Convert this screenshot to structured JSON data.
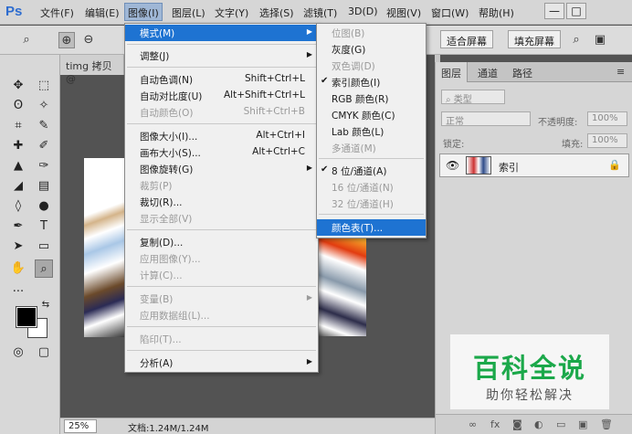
{
  "app": {
    "logo": "Ps"
  },
  "menubar": {
    "items": [
      "文件(F)",
      "编辑(E)",
      "图像(I)",
      "图层(L)",
      "文字(Y)",
      "选择(S)",
      "滤镜(T)",
      "3D(D)",
      "视图(V)",
      "窗口(W)",
      "帮助(H)"
    ],
    "window_buttons": [
      "—",
      "□"
    ]
  },
  "options_bar": {
    "fit_screen": "适合屏幕",
    "fill_screen": "填充屏幕"
  },
  "document": {
    "tab_title": "timg 拷贝 @",
    "zoom": "25%",
    "info": "文档:1.24M/1.24M"
  },
  "image_menu": [
    {
      "label": "模式(M)",
      "shortcut": "",
      "submenu": true,
      "disabled": false,
      "highlighted": true
    },
    {
      "label": "调整(J)",
      "shortcut": "",
      "submenu": true,
      "disabled": false
    },
    {
      "label": "自动色调(N)",
      "shortcut": "Shift+Ctrl+L",
      "disabled": false
    },
    {
      "label": "自动对比度(U)",
      "shortcut": "Alt+Shift+Ctrl+L",
      "disabled": false
    },
    {
      "label": "自动颜色(O)",
      "shortcut": "Shift+Ctrl+B",
      "disabled": true
    },
    {
      "label": "图像大小(I)...",
      "shortcut": "Alt+Ctrl+I",
      "disabled": false
    },
    {
      "label": "画布大小(S)...",
      "shortcut": "Alt+Ctrl+C",
      "disabled": false
    },
    {
      "label": "图像旋转(G)",
      "shortcut": "",
      "submenu": true,
      "disabled": false
    },
    {
      "label": "裁剪(P)",
      "shortcut": "",
      "disabled": true
    },
    {
      "label": "裁切(R)...",
      "shortcut": "",
      "disabled": false
    },
    {
      "label": "显示全部(V)",
      "shortcut": "",
      "disabled": true
    },
    {
      "label": "复制(D)...",
      "shortcut": "",
      "disabled": false
    },
    {
      "label": "应用图像(Y)...",
      "shortcut": "",
      "disabled": true
    },
    {
      "label": "计算(C)...",
      "shortcut": "",
      "disabled": true
    },
    {
      "label": "变量(B)",
      "shortcut": "",
      "submenu": true,
      "disabled": true
    },
    {
      "label": "应用数据组(L)...",
      "shortcut": "",
      "disabled": true
    },
    {
      "label": "陷印(T)...",
      "shortcut": "",
      "disabled": true
    },
    {
      "label": "分析(A)",
      "shortcut": "",
      "submenu": true,
      "disabled": false
    }
  ],
  "mode_submenu": [
    {
      "label": "位图(B)",
      "checked": false,
      "disabled": true
    },
    {
      "label": "灰度(G)",
      "checked": false,
      "disabled": false
    },
    {
      "label": "双色调(D)",
      "checked": false,
      "disabled": true
    },
    {
      "label": "索引颜色(I)",
      "checked": true,
      "disabled": false
    },
    {
      "label": "RGB 颜色(R)",
      "checked": false,
      "disabled": false
    },
    {
      "label": "CMYK 颜色(C)",
      "checked": false,
      "disabled": false
    },
    {
      "label": "Lab 颜色(L)",
      "checked": false,
      "disabled": false
    },
    {
      "label": "多通道(M)",
      "checked": false,
      "disabled": true
    },
    {
      "label": "8 位/通道(A)",
      "checked": true,
      "disabled": false
    },
    {
      "label": "16 位/通道(N)",
      "checked": false,
      "disabled": true
    },
    {
      "label": "32 位/通道(H)",
      "checked": false,
      "disabled": true
    },
    {
      "label": "颜色表(T)...",
      "checked": false,
      "disabled": false,
      "highlighted": true
    }
  ],
  "layers_panel": {
    "tabs": [
      "图层",
      "通道",
      "路径"
    ],
    "kind_filter": "类型",
    "blend_mode": "正常",
    "opacity_label": "不透明度:",
    "opacity_value": "100%",
    "lock_label": "锁定:",
    "fill_label": "填充:",
    "fill_value": "100%",
    "layer_name": "索引"
  },
  "watermark": {
    "title": "百科全说",
    "subtitle": "助你轻松解决"
  },
  "colors": {
    "menu_highlight": "#1e73d2",
    "brand_green": "#1ba84a"
  }
}
